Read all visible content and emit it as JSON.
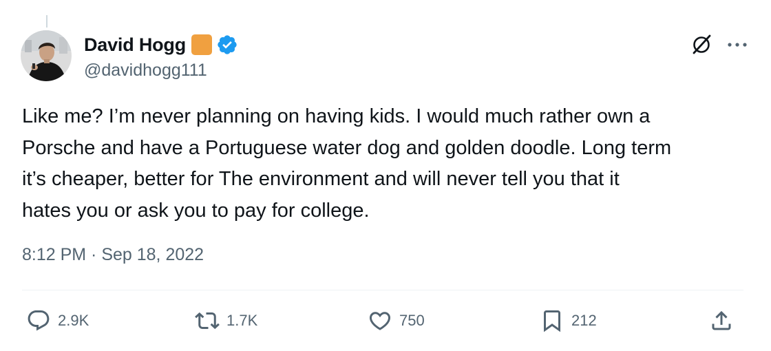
{
  "author": {
    "display_name": "David Hogg",
    "handle": "@davidhogg111",
    "verified": true,
    "badge_color": "#f0a040",
    "verified_color": "#1d9bf0"
  },
  "tweet": {
    "text": "Like me? I’m never planning on having kids. I would much rather own a\nPorsche and have a Portuguese water dog and golden doodle. Long term\nit’s cheaper, better for The environment and will never tell you that it\nhates you or ask you to pay for college.",
    "timestamp": "8:12 PM · Sep 18, 2022"
  },
  "actions": {
    "replies": "2.9K",
    "reposts": "1.7K",
    "likes": "750",
    "bookmarks": "212"
  },
  "icons": {
    "top_right": [
      "grok-icon",
      "more-icon"
    ],
    "action_bar": [
      "reply-icon",
      "repost-icon",
      "like-icon",
      "bookmark-icon",
      "share-icon"
    ]
  },
  "colors": {
    "text_primary": "#0f1419",
    "text_secondary": "#536471",
    "divider": "#eff3f4"
  }
}
